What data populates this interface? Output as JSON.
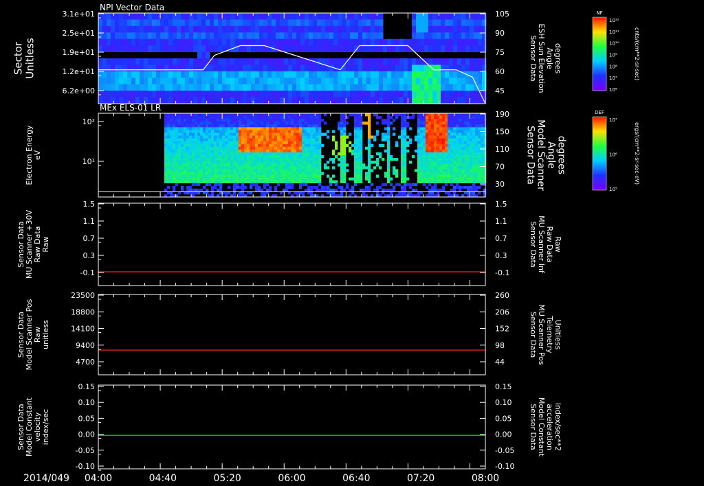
{
  "date_label": "2014/049",
  "x_ticks": [
    "04:00",
    "04:40",
    "05:20",
    "06:00",
    "06:40",
    "07:20",
    "08:00"
  ],
  "panels": [
    {
      "title": "NPI Vector Data",
      "ylabel": [
        "Sector",
        "Unitless"
      ],
      "y_ticks": [
        "3.1e+01",
        "2.5e+01",
        "1.9e+01",
        "1.2e+01",
        "6.2e+00"
      ],
      "y2label": [
        "Sensor Data",
        "ESH Sun Elevation",
        "Angle",
        "degrees"
      ],
      "y2_ticks": [
        "105",
        "90",
        "75",
        "60",
        "45"
      ],
      "cbar_label": "NF",
      "cbar_ticks": [
        "10¹²",
        "10¹¹",
        "10¹⁰",
        "10⁹",
        "10⁸",
        "10⁷",
        "10⁶"
      ],
      "cbar_units": "cnts/(cm**2-sr-sec)"
    },
    {
      "title": "MEx ELS-01 LR",
      "ylabel": [
        "Electron Energy",
        "eV"
      ],
      "y_ticks": [
        "10²",
        "10¹"
      ],
      "y2label": [
        "Sensor Data",
        "Model Scanner",
        "Angle",
        "degrees"
      ],
      "y2_ticks": [
        "190",
        "150",
        "110",
        "70",
        "30"
      ],
      "cbar_label": "DEF",
      "cbar_ticks": [
        "10⁷",
        "10⁶",
        "10⁵"
      ],
      "cbar_units": "ergs/(cm**2-sr-sec-eV)"
    },
    {
      "ylabel": [
        "Sensor Data",
        "MU Scanner +30V",
        "Raw Data",
        "Raw"
      ],
      "y_ticks": [
        "1.5",
        "1.1",
        "0.7",
        "0.3",
        "-0.1"
      ],
      "y2label": [
        "Sensor Data",
        "MU Scanner Inf",
        "Raw Data",
        "Raw"
      ],
      "y2_ticks": [
        "1.5",
        "1.1",
        "0.7",
        "0.3",
        "-0.1"
      ],
      "y2_color": "#ff2020",
      "line_color": "#ff2020"
    },
    {
      "ylabel": [
        "Sensor Data",
        "Model Scanner Pos",
        "Raw",
        "unitless"
      ],
      "y_ticks": [
        "23500",
        "18800",
        "14100",
        "9400",
        "4700"
      ],
      "y2label": [
        "Sensor Data",
        "MU Scanner Pos",
        "Telemetry",
        "Unitless"
      ],
      "y2_ticks": [
        "260",
        "206",
        "152",
        "98",
        "44"
      ],
      "y2_color": "#ff2020",
      "line_color": "#ff2020"
    },
    {
      "ylabel": [
        "Sensor Data",
        "Model Constant",
        "velocity",
        "index/sec"
      ],
      "y_ticks": [
        "0.15",
        "0.10",
        "0.05",
        "0.00",
        "-0.05",
        "-0.10"
      ],
      "y2label": [
        "Sensor Data",
        "Model Constant",
        "acceleration",
        "index/sec**2"
      ],
      "y2_ticks": [
        "0.15",
        "0.10",
        "0.05",
        "0.00",
        "-0.05",
        "-0.10"
      ],
      "y2_color": "#20e020",
      "line_color": "#20e020"
    }
  ],
  "chart_data": [
    {
      "type": "heatmap",
      "title": "NPI Vector Data",
      "x_range": [
        "04:00",
        "08:00"
      ],
      "ylabel": "Sector Unitless",
      "y_ticks": [
        31,
        25,
        19,
        12,
        6.2
      ],
      "overlay_series": {
        "name": "Sensor Data ESH Sun Elevation Angle degrees",
        "x": [
          "04:00",
          "05:05",
          "05:12",
          "05:28",
          "05:43",
          "06:30",
          "06:42",
          "07:12",
          "07:28",
          "07:42",
          "07:52",
          "08:00"
        ],
        "y": [
          58,
          58,
          70,
          78,
          78,
          58,
          78,
          78,
          58,
          58,
          52,
          30
        ],
        "y2_range": [
          30,
          105
        ]
      }
    },
    {
      "type": "heatmap",
      "title": "MEx ELS-01 LR",
      "x_range": [
        "04:00",
        "08:00"
      ],
      "ylabel": "Electron Energy eV",
      "y_scale": "log",
      "overlay_series": {
        "name": "Sensor Data Model Scanner Angle degrees",
        "x": [
          "04:00",
          "08:00"
        ],
        "y": [
          12,
          12
        ],
        "y2_range": [
          0,
          190
        ]
      }
    },
    {
      "type": "line",
      "x": [
        "04:00",
        "08:00"
      ],
      "series": [
        {
          "name": "Sensor Data MU Scanner Inf Raw Data Raw",
          "values": [
            0.0,
            0.0
          ]
        }
      ],
      "ylim": [
        -0.3,
        1.5
      ]
    },
    {
      "type": "line",
      "x": [
        "04:00",
        "08:00"
      ],
      "series": [
        {
          "name": "Sensor Data MU Scanner Pos Telemetry Unitless",
          "values": [
            80,
            80
          ]
        }
      ],
      "y2lim": [
        0,
        260
      ]
    },
    {
      "type": "line",
      "x": [
        "04:00",
        "08:00"
      ],
      "series": [
        {
          "name": "Sensor Data Model Constant acceleration index/sec**2",
          "values": [
            0.0,
            0.0
          ]
        }
      ],
      "ylim": [
        -0.1,
        0.15
      ]
    }
  ]
}
